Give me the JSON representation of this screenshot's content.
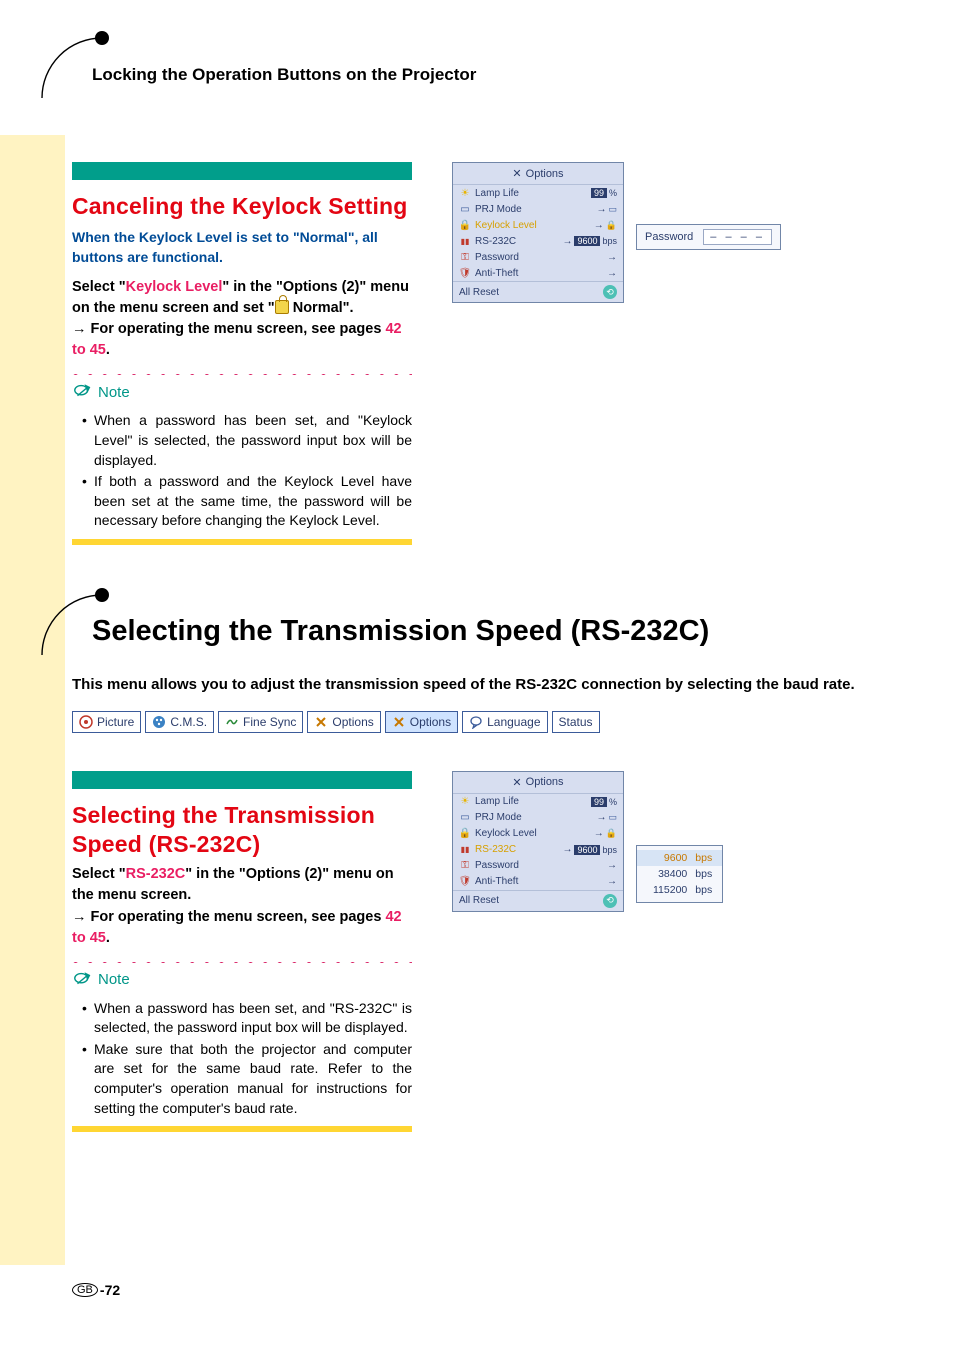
{
  "header": {
    "breadcrumb": "Locking the Operation Buttons on the Projector"
  },
  "section1": {
    "heading": "Canceling the Keylock Setting",
    "intro": "When the Keylock Level is set to \"Normal\", all buttons are functional.",
    "instr_pre": "Select \"",
    "instr_link": "Keylock Level",
    "instr_mid": "\" in the \"Options (2)\" menu on the menu screen and set \"",
    "instr_post": " Normal\".",
    "forop_pre": "→ For operating the menu screen, see pages ",
    "forop_link": "42 to 45",
    "forop_post": ".",
    "note_label": "Note",
    "notes": [
      "When a password has been set, and \"Keylock Level\" is selected, the password input box will be displayed.",
      "If both a password and the Keylock Level have been set at the same time, the password will be necessary before changing the Keylock Level."
    ]
  },
  "osd1": {
    "title": "Options",
    "rows": {
      "lamp": {
        "label": "Lamp Life",
        "value": "99",
        "unit": "%"
      },
      "prj": {
        "label": "PRJ Mode"
      },
      "keylock": {
        "label": "Keylock Level"
      },
      "rs232c": {
        "label": "RS-232C",
        "value": "9600",
        "unit": "bps"
      },
      "password": {
        "label": "Password"
      },
      "antitheft": {
        "label": "Anti-Theft"
      }
    },
    "reset": "All Reset"
  },
  "pwpopup": {
    "label": "Password",
    "value": "– – – –"
  },
  "section2": {
    "big_heading": "Selecting the Transmission Speed (RS-232C)",
    "big_intro": "This menu allows you to adjust the transmission speed of the RS-232C connection by selecting the baud rate."
  },
  "tabs": {
    "picture": "Picture",
    "cms": "C.M.S.",
    "finesync": "Fine Sync",
    "options1": "Options",
    "options2": "Options",
    "language": "Language",
    "status": "Status"
  },
  "section3": {
    "heading": "Selecting the Transmission Speed (RS-232C)",
    "instr_pre": "Select \"",
    "instr_link": "RS-232C",
    "instr_mid": "\" in the \"Options (2)\" menu on the menu screen.",
    "forop_pre": "→ For operating the menu screen, see pages ",
    "forop_link": "42 to 45",
    "forop_post": ".",
    "note_label": "Note",
    "notes": [
      "When a password has been set, and \"RS-232C\" is selected, the password input box will be displayed.",
      "Make sure that both the projector and computer are set for the same baud rate. Refer to the computer's operation manual for instructions for setting the computer's baud rate."
    ]
  },
  "osd2": {
    "title": "Options",
    "rows": {
      "lamp": {
        "label": "Lamp Life",
        "value": "99",
        "unit": "%"
      },
      "prj": {
        "label": "PRJ Mode"
      },
      "keylock": {
        "label": "Keylock Level"
      },
      "rs232c": {
        "label": "RS-232C",
        "value": "9600",
        "unit": "bps"
      },
      "password": {
        "label": "Password"
      },
      "antitheft": {
        "label": "Anti-Theft"
      }
    },
    "reset": "All Reset"
  },
  "bps": {
    "options": [
      {
        "value": "9600",
        "unit": "bps"
      },
      {
        "value": "38400",
        "unit": "bps"
      },
      {
        "value": "115200",
        "unit": "bps"
      }
    ]
  },
  "footer": {
    "region": "GB",
    "page": "-72"
  }
}
